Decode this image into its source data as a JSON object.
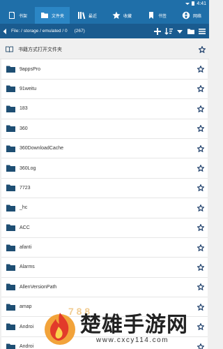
{
  "status_bar": {
    "time": "4:41"
  },
  "tabs": [
    {
      "label": "书架",
      "icon": "home-icon",
      "active": false
    },
    {
      "label": "文件夹",
      "icon": "folder-icon",
      "active": true
    },
    {
      "label": "最近",
      "icon": "books-icon",
      "active": false
    },
    {
      "label": "收藏",
      "icon": "star-icon",
      "active": false
    },
    {
      "label": "书签",
      "icon": "bookmark-icon",
      "active": false
    },
    {
      "label": "网络",
      "icon": "globe-icon",
      "active": false
    }
  ],
  "path_bar": {
    "path": "File: / storage / emulated / 0",
    "count": "(267)"
  },
  "open_as_book_label": "书籍方式打开文件夹",
  "folders": [
    "9appsPro",
    "91weitu",
    "183",
    "360",
    "360DownloadCache",
    "360Log",
    "7723",
    "_hc",
    "ACC",
    "afanti",
    "Alarms",
    "AllenVersionPath",
    "amap",
    "Androi",
    "Androi"
  ],
  "watermark": {
    "title": "楚雄手游网",
    "url": "www.cxcy114.com"
  },
  "colors": {
    "tab_bar": "#1f6fa9",
    "active_tab": "#2b86c5",
    "path_bar": "#1a5b8f",
    "folder_icon": "#1e4e73"
  }
}
